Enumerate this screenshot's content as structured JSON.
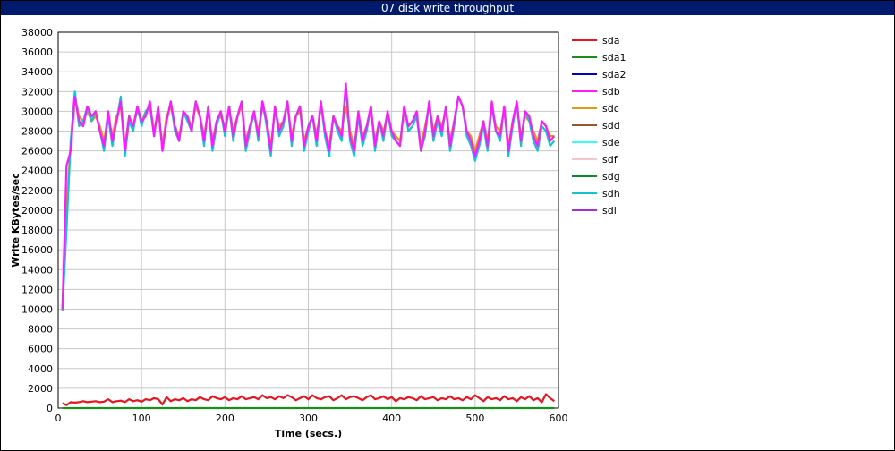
{
  "window": {
    "title": "07 disk write throughput"
  },
  "chart_data": {
    "type": "line",
    "title": "07 disk write throughput",
    "xlabel": "Time (secs.)",
    "ylabel": "Write KBytes/sec",
    "xlim": [
      0,
      600
    ],
    "ylim": [
      0,
      38000
    ],
    "grid": true,
    "legend_position": "right",
    "x_ticks": [
      0,
      100,
      200,
      300,
      400,
      500,
      600
    ],
    "y_ticks": [
      0,
      2000,
      4000,
      6000,
      8000,
      10000,
      12000,
      14000,
      16000,
      18000,
      20000,
      22000,
      24000,
      26000,
      28000,
      30000,
      32000,
      34000,
      36000,
      38000
    ],
    "x": [
      5,
      10,
      15,
      20,
      25,
      30,
      35,
      40,
      45,
      50,
      55,
      60,
      65,
      70,
      75,
      80,
      85,
      90,
      95,
      100,
      105,
      110,
      115,
      120,
      125,
      130,
      135,
      140,
      145,
      150,
      155,
      160,
      165,
      170,
      175,
      180,
      185,
      190,
      195,
      200,
      205,
      210,
      215,
      220,
      225,
      230,
      235,
      240,
      245,
      250,
      255,
      260,
      265,
      270,
      275,
      280,
      285,
      290,
      295,
      300,
      305,
      310,
      315,
      320,
      325,
      330,
      335,
      340,
      345,
      350,
      355,
      360,
      365,
      370,
      375,
      380,
      385,
      390,
      395,
      400,
      405,
      410,
      415,
      420,
      425,
      430,
      435,
      440,
      445,
      450,
      455,
      460,
      465,
      470,
      475,
      480,
      485,
      490,
      495,
      500,
      505,
      510,
      515,
      520,
      525,
      530,
      535,
      540,
      545,
      550,
      555,
      560,
      565,
      570,
      575,
      580,
      585,
      590,
      595
    ],
    "series": [
      {
        "name": "sda",
        "color": "#e8141e",
        "values": [
          500,
          300,
          600,
          550,
          600,
          700,
          600,
          650,
          700,
          600,
          650,
          900,
          600,
          700,
          750,
          600,
          900,
          700,
          800,
          650,
          900,
          800,
          1000,
          900,
          350,
          1100,
          700,
          900,
          800,
          1000,
          700,
          900,
          800,
          1100,
          900,
          800,
          1200,
          1000,
          900,
          1100,
          800,
          1000,
          900,
          1200,
          900,
          1000,
          1100,
          900,
          1300,
          1000,
          1100,
          900,
          1200,
          1000,
          1300,
          1100,
          800,
          1000,
          1200,
          900,
          1300,
          1000,
          900,
          1100,
          1200,
          800,
          1000,
          1300,
          900,
          1100,
          1200,
          1000,
          800,
          1100,
          1300,
          900,
          1000,
          1200,
          900,
          1100,
          700,
          1000,
          900,
          1100,
          1000,
          800,
          1200,
          900,
          1000,
          1100,
          800,
          1000,
          900,
          1200,
          900,
          1000,
          800,
          1100,
          900,
          1300,
          1000,
          700,
          1100,
          900,
          1000,
          800,
          1200,
          900,
          1000,
          700,
          1100,
          900,
          1200,
          800,
          1000,
          600,
          1400,
          1000,
          700
        ]
      },
      {
        "name": "sda1",
        "color": "#1a8f1a",
        "values": [
          0,
          0,
          0,
          0,
          0,
          0,
          0,
          0,
          0,
          0,
          0,
          0,
          0,
          0,
          0,
          0,
          0,
          0,
          0,
          0,
          0,
          0,
          0,
          0,
          0,
          0,
          0,
          0,
          0,
          0,
          0,
          0,
          0,
          0,
          0,
          0,
          0,
          0,
          0,
          0,
          0,
          0,
          0,
          0,
          0,
          0,
          0,
          0,
          0,
          0,
          0,
          0,
          0,
          0,
          0,
          0,
          0,
          0,
          0,
          0,
          0,
          0,
          0,
          0,
          0,
          0,
          0,
          0,
          0,
          0,
          0,
          0,
          0,
          0,
          0,
          0,
          0,
          0,
          0,
          0,
          0,
          0,
          0,
          0,
          0,
          0,
          0,
          0,
          0,
          0,
          0,
          0,
          0,
          0,
          0,
          0,
          0,
          0,
          0,
          0,
          0,
          0,
          0,
          0,
          0,
          0,
          0,
          0,
          0,
          0,
          0,
          0,
          0,
          0,
          0,
          0,
          0,
          0,
          0
        ]
      },
      {
        "name": "sda2",
        "color": "#0000c8",
        "values": []
      },
      {
        "name": "sdb",
        "color": "#ff19ff",
        "values": [
          10000,
          24500,
          26000,
          31500,
          29000,
          28500,
          30500,
          29500,
          30000,
          28000,
          26500,
          30000,
          27000,
          29000,
          31000,
          26000,
          29500,
          28500,
          30500,
          29000,
          29500,
          31000,
          27500,
          30500,
          26000,
          29000,
          31000,
          28500,
          27000,
          30000,
          29500,
          28000,
          31000,
          29500,
          27000,
          30500,
          26500,
          29000,
          30000,
          28000,
          30500,
          27500,
          29500,
          31000,
          26500,
          28500,
          30000,
          27500,
          31000,
          29000,
          26000,
          30500,
          28000,
          29000,
          31000,
          27000,
          29500,
          30500,
          26500,
          28500,
          29500,
          27000,
          31000,
          28000,
          26000,
          29500,
          28500,
          27500,
          32800,
          27500,
          26000,
          30000,
          27000,
          28500,
          30500,
          26500,
          29000,
          27500,
          30000,
          28000,
          27000,
          26500,
          30500,
          28500,
          29000,
          30000,
          26000,
          28000,
          31000,
          27500,
          29500,
          28000,
          30500,
          26500,
          29000,
          31500,
          30500,
          28000,
          27000,
          25500,
          27000,
          29000,
          26500,
          31000,
          28000,
          27500,
          30500,
          26000,
          29000,
          31000,
          27000,
          30000,
          29500,
          27500,
          26500,
          29000,
          28500,
          27000,
          27500
        ]
      },
      {
        "name": "sdc",
        "color": "#e8960f",
        "values": [
          9800,
          20000,
          27000,
          31500,
          29500,
          29000,
          30000,
          29000,
          29500,
          28500,
          27000,
          29500,
          27500,
          29500,
          30500,
          26500,
          29500,
          28500,
          30000,
          29000,
          30000,
          30500,
          28000,
          30000,
          26500,
          29500,
          30500,
          28500,
          27500,
          29500,
          29500,
          28500,
          30500,
          29500,
          27500,
          30000,
          27000,
          29000,
          29500,
          28500,
          30000,
          28000,
          29500,
          30500,
          27000,
          28500,
          29500,
          28000,
          30500,
          29000,
          26500,
          30000,
          28500,
          29000,
          30500,
          27500,
          29500,
          30000,
          27000,
          28500,
          29500,
          27500,
          30500,
          28000,
          26500,
          29500,
          28500,
          28000,
          30500,
          28000,
          26500,
          29500,
          27500,
          28500,
          30000,
          27000,
          29000,
          28000,
          29500,
          28000,
          27500,
          27000,
          30000,
          28500,
          29000,
          29500,
          26500,
          28500,
          30500,
          28000,
          29500,
          28500,
          30000,
          27000,
          29000,
          31500,
          30500,
          28000,
          27500,
          26000,
          27500,
          29000,
          27000,
          30500,
          28500,
          28000,
          30000,
          26500,
          29000,
          30500,
          27500,
          29500,
          29000,
          28000,
          27000,
          29000,
          28500,
          27500,
          27500
        ]
      },
      {
        "name": "sdd",
        "color": "#a0522d",
        "values": []
      },
      {
        "name": "sde",
        "color": "#33ffff",
        "values": []
      },
      {
        "name": "sdf",
        "color": "#f4c8c8",
        "values": []
      },
      {
        "name": "sdg",
        "color": "#0a8a2a",
        "values": []
      },
      {
        "name": "sdh",
        "color": "#14c3d2",
        "values": [
          9800,
          18000,
          27000,
          32000,
          28500,
          29000,
          30500,
          29000,
          30000,
          28000,
          26000,
          29500,
          26500,
          29000,
          31500,
          25500,
          29000,
          28000,
          30500,
          28500,
          30000,
          30500,
          27500,
          30500,
          26000,
          29000,
          31000,
          28000,
          27000,
          30000,
          29000,
          28000,
          31000,
          29500,
          26500,
          30500,
          26000,
          28500,
          30000,
          27500,
          30500,
          27000,
          29500,
          31000,
          26000,
          28000,
          30000,
          27000,
          31000,
          28500,
          25500,
          30500,
          27500,
          28500,
          31000,
          26500,
          29500,
          30500,
          26000,
          28000,
          29500,
          26500,
          31000,
          27500,
          25500,
          29500,
          28000,
          27000,
          32500,
          27000,
          25500,
          29500,
          26500,
          28000,
          30500,
          26000,
          29000,
          27000,
          30000,
          27500,
          27000,
          26500,
          30500,
          28000,
          28500,
          29500,
          26000,
          27500,
          31000,
          27000,
          29000,
          27500,
          30500,
          26000,
          28500,
          31500,
          30500,
          27500,
          26500,
          25000,
          26500,
          28500,
          26000,
          30500,
          28000,
          27000,
          30500,
          25500,
          28500,
          31000,
          26500,
          30000,
          29000,
          27000,
          26000,
          28500,
          28000,
          26500,
          27000
        ]
      },
      {
        "name": "sdi",
        "color": "#a62ed2",
        "values": []
      }
    ]
  },
  "legend": {
    "items": [
      {
        "label": "sda",
        "color": "#e8141e"
      },
      {
        "label": "sda1",
        "color": "#1a8f1a"
      },
      {
        "label": "sda2",
        "color": "#0000c8"
      },
      {
        "label": "sdb",
        "color": "#ff19ff"
      },
      {
        "label": "sdc",
        "color": "#e8960f"
      },
      {
        "label": "sdd",
        "color": "#a0522d"
      },
      {
        "label": "sde",
        "color": "#33ffff"
      },
      {
        "label": "sdf",
        "color": "#f4c8c8"
      },
      {
        "label": "sdg",
        "color": "#0a8a2a"
      },
      {
        "label": "sdh",
        "color": "#14c3d2"
      },
      {
        "label": "sdi",
        "color": "#a62ed2"
      }
    ]
  }
}
